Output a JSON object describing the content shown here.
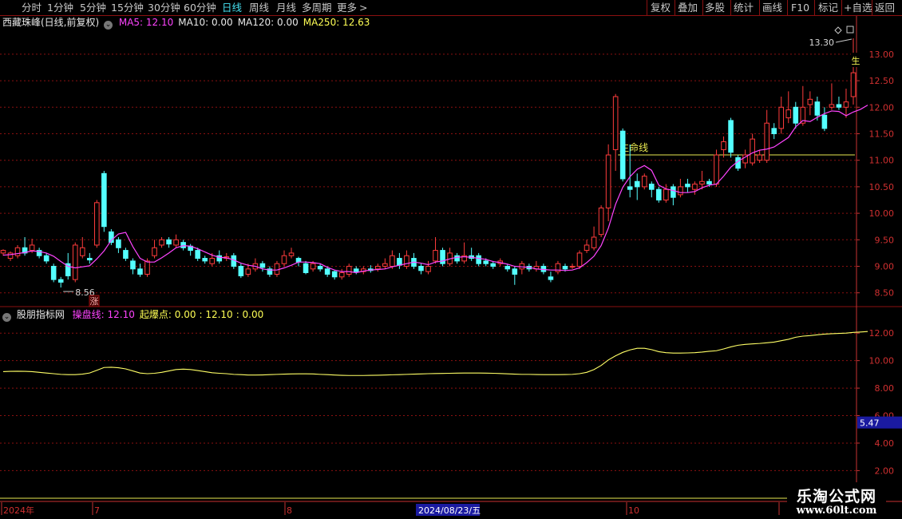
{
  "toolbar": {
    "periods": [
      {
        "label": "分时",
        "active": false
      },
      {
        "label": "1分钟",
        "active": false
      },
      {
        "label": "5分钟",
        "active": false
      },
      {
        "label": "15分钟",
        "active": false
      },
      {
        "label": "30分钟",
        "active": false
      },
      {
        "label": "60分钟",
        "active": false
      },
      {
        "label": "日线",
        "active": true
      },
      {
        "label": "周线",
        "active": false
      },
      {
        "label": "月线",
        "active": false
      },
      {
        "label": "多周期",
        "active": false
      },
      {
        "label": "更多",
        "active": false
      }
    ],
    "more_arrow": ">",
    "tools": [
      "复权",
      "叠加",
      "多股",
      "统计",
      "画线",
      "F10",
      "标记",
      "+自选",
      "返回"
    ]
  },
  "header": {
    "stock_title": "西藏珠峰(日线,前复权)",
    "ma_labels": [
      {
        "text": "MA5: 12.10",
        "color": "#ff44ff"
      },
      {
        "text": "MA10: 0.00",
        "color": "#e8e8e8"
      },
      {
        "text": "MA120: 0.00",
        "color": "#e8e8e8"
      },
      {
        "text": "MA250: 12.63",
        "color": "#ffff55"
      }
    ]
  },
  "indicator_header": {
    "name": "股朋指标网",
    "items": [
      {
        "text": "操盘线: 12.10",
        "color": "#ff44ff"
      },
      {
        "text": "起爆点: 0.00",
        "color": "#ffff55"
      },
      {
        "text": ": 12.10",
        "color": "#ffff55"
      },
      {
        "text": ": 0.00",
        "color": "#ffff55"
      }
    ]
  },
  "annotations": {
    "high_label": "13.30",
    "low_label": "8.56",
    "shengming": "生命线",
    "zhang": "涨",
    "sheng_edge": "生",
    "crosshair_value": "5.47"
  },
  "date_axis": {
    "labels": [
      "2024年",
      "7",
      "8",
      "10"
    ],
    "cursor_date": "2024/08/23/五"
  },
  "watermark": {
    "line1": "乐淘公式网",
    "line2": "www.60lt.com"
  },
  "colors": {
    "up": "#ff3c3c",
    "down": "#54ffff",
    "ma": "#ff44ff",
    "indicator": "#ffff66",
    "grid": "#8b1010",
    "axis": "#c83232",
    "level": "#e8e850"
  },
  "chart_data": {
    "type": "candlestick",
    "price_ylim": [
      8.3,
      13.45
    ],
    "price_ticks": [
      "13.00",
      "12.50",
      "12.00",
      "11.50",
      "11.00",
      "10.50",
      "10.00",
      "9.50",
      "9.00",
      "8.50"
    ],
    "indicator_ylim": [
      1.5,
      13.0
    ],
    "indicator_ticks": [
      "12.00",
      "10.00",
      "8.00",
      "6.00",
      "4.00",
      "2.00"
    ],
    "level_line": 11.1,
    "candles": [
      [
        9.25,
        9.3,
        9.2,
        9.32
      ],
      [
        9.15,
        9.25,
        9.1,
        9.28
      ],
      [
        9.2,
        9.35,
        9.15,
        9.4
      ],
      [
        9.35,
        9.25,
        9.2,
        9.55
      ],
      [
        9.3,
        9.4,
        9.25,
        9.52
      ],
      [
        9.3,
        9.2,
        9.15,
        9.35
      ],
      [
        9.2,
        9.1,
        9.05,
        9.25
      ],
      [
        9.0,
        8.75,
        8.7,
        9.05
      ],
      [
        8.75,
        8.7,
        8.6,
        8.8
      ],
      [
        9.05,
        8.82,
        8.75,
        9.25
      ],
      [
        8.75,
        9.4,
        8.7,
        9.45
      ],
      [
        9.2,
        9.35,
        9.15,
        9.55
      ],
      [
        9.15,
        9.12,
        9.05,
        9.25
      ],
      [
        9.4,
        10.2,
        9.35,
        10.25
      ],
      [
        10.75,
        9.75,
        9.65,
        10.8
      ],
      [
        9.65,
        9.45,
        9.4,
        9.7
      ],
      [
        9.5,
        9.35,
        9.25,
        9.55
      ],
      [
        9.3,
        9.15,
        9.1,
        9.35
      ],
      [
        9.1,
        8.95,
        8.85,
        9.15
      ],
      [
        8.95,
        8.85,
        8.8,
        9.05
      ],
      [
        8.85,
        9.1,
        8.8,
        9.15
      ],
      [
        9.2,
        9.35,
        9.15,
        9.5
      ],
      [
        9.4,
        9.5,
        9.35,
        9.55
      ],
      [
        9.5,
        9.42,
        9.35,
        9.55
      ],
      [
        9.4,
        9.5,
        9.35,
        9.6
      ],
      [
        9.45,
        9.35,
        9.3,
        9.5
      ],
      [
        9.38,
        9.3,
        9.2,
        9.42
      ],
      [
        9.3,
        9.15,
        9.1,
        9.35
      ],
      [
        9.15,
        9.1,
        9.05,
        9.2
      ],
      [
        9.05,
        9.15,
        9.0,
        9.25
      ],
      [
        9.2,
        9.1,
        9.05,
        9.3
      ],
      [
        9.15,
        9.18,
        9.1,
        9.25
      ],
      [
        9.2,
        9.0,
        8.95,
        9.25
      ],
      [
        9.0,
        8.82,
        8.78,
        9.05
      ],
      [
        8.85,
        8.95,
        8.8,
        9.05
      ],
      [
        8.95,
        9.05,
        8.9,
        9.15
      ],
      [
        9.05,
        8.98,
        8.9,
        9.1
      ],
      [
        8.95,
        8.85,
        8.8,
        9.0
      ],
      [
        8.85,
        9.05,
        8.8,
        9.1
      ],
      [
        9.05,
        9.2,
        9.0,
        9.3
      ],
      [
        9.2,
        9.25,
        9.15,
        9.35
      ],
      [
        9.15,
        9.08,
        9.0,
        9.18
      ],
      [
        9.05,
        8.88,
        8.85,
        9.1
      ],
      [
        8.95,
        9.05,
        8.9,
        9.1
      ],
      [
        9.0,
        8.95,
        8.9,
        9.05
      ],
      [
        8.95,
        8.85,
        8.8,
        9.0
      ],
      [
        8.9,
        8.8,
        8.75,
        8.92
      ],
      [
        8.8,
        8.88,
        8.75,
        8.95
      ],
      [
        8.85,
        9.0,
        8.8,
        9.05
      ],
      [
        8.95,
        8.9,
        8.85,
        9.0
      ],
      [
        8.9,
        8.95,
        8.85,
        9.0
      ],
      [
        8.95,
        8.92,
        8.88,
        9.02
      ],
      [
        8.95,
        9.0,
        8.9,
        9.05
      ],
      [
        9.0,
        9.05,
        8.95,
        9.15
      ],
      [
        9.0,
        9.2,
        8.95,
        9.3
      ],
      [
        9.15,
        9.02,
        8.95,
        9.25
      ],
      [
        9.0,
        9.2,
        8.95,
        9.3
      ],
      [
        9.15,
        9.0,
        8.95,
        9.25
      ],
      [
        9.0,
        8.92,
        8.85,
        9.05
      ],
      [
        8.9,
        9.0,
        8.85,
        9.1
      ],
      [
        9.1,
        9.3,
        9.05,
        9.55
      ],
      [
        9.3,
        9.05,
        9.0,
        9.35
      ],
      [
        9.05,
        9.25,
        9.0,
        9.35
      ],
      [
        9.2,
        9.1,
        9.05,
        9.25
      ],
      [
        9.1,
        9.2,
        9.05,
        9.45
      ],
      [
        9.2,
        9.15,
        9.1,
        9.35
      ],
      [
        9.2,
        9.05,
        9.0,
        9.25
      ],
      [
        9.1,
        9.05,
        9.0,
        9.15
      ],
      [
        9.05,
        9.0,
        8.95,
        9.1
      ],
      [
        9.05,
        9.1,
        9.0,
        9.15
      ],
      [
        9.0,
        8.95,
        8.9,
        9.05
      ],
      [
        8.95,
        8.85,
        8.65,
        9.0
      ],
      [
        8.95,
        9.05,
        8.85,
        9.1
      ],
      [
        9.0,
        8.95,
        8.9,
        9.05
      ],
      [
        8.95,
        9.0,
        8.9,
        9.1
      ],
      [
        9.0,
        8.9,
        8.85,
        9.05
      ],
      [
        8.8,
        8.75,
        8.7,
        8.9
      ],
      [
        8.9,
        9.05,
        8.85,
        9.1
      ],
      [
        9.0,
        8.95,
        8.9,
        9.05
      ],
      [
        9.0,
        9.0,
        8.95,
        9.05
      ],
      [
        9.0,
        9.25,
        8.95,
        9.3
      ],
      [
        9.3,
        9.4,
        9.25,
        9.5
      ],
      [
        9.35,
        9.55,
        9.3,
        9.75
      ],
      [
        9.6,
        10.1,
        9.55,
        10.15
      ],
      [
        10.1,
        11.1,
        9.85,
        11.3
      ],
      [
        11.2,
        12.2,
        10.8,
        12.25
      ],
      [
        11.55,
        10.65,
        10.6,
        11.6
      ],
      [
        10.5,
        10.45,
        10.3,
        11.3
      ],
      [
        10.6,
        10.5,
        10.25,
        10.75
      ],
      [
        10.5,
        10.7,
        10.45,
        10.75
      ],
      [
        10.55,
        10.45,
        10.3,
        10.6
      ],
      [
        10.45,
        10.25,
        10.2,
        10.5
      ],
      [
        10.25,
        10.45,
        10.2,
        10.55
      ],
      [
        10.5,
        10.3,
        10.15,
        10.55
      ],
      [
        10.35,
        10.5,
        10.3,
        10.65
      ],
      [
        10.55,
        10.5,
        10.4,
        10.65
      ],
      [
        10.45,
        10.55,
        10.35,
        10.6
      ],
      [
        10.55,
        10.6,
        10.45,
        10.8
      ],
      [
        10.6,
        10.55,
        10.5,
        10.65
      ],
      [
        10.55,
        11.1,
        10.5,
        11.2
      ],
      [
        11.2,
        11.35,
        11.05,
        11.45
      ],
      [
        11.75,
        11.15,
        11.05,
        11.8
      ],
      [
        11.05,
        10.85,
        10.8,
        11.1
      ],
      [
        10.95,
        11.1,
        10.85,
        11.2
      ],
      [
        10.95,
        11.4,
        10.9,
        11.5
      ],
      [
        11.0,
        11.1,
        10.95,
        11.2
      ],
      [
        11.0,
        11.7,
        10.95,
        11.95
      ],
      [
        11.6,
        11.5,
        11.4,
        11.7
      ],
      [
        11.6,
        12.0,
        11.5,
        12.2
      ],
      [
        11.8,
        11.95,
        11.7,
        12.3
      ],
      [
        12.0,
        11.7,
        11.6,
        12.1
      ],
      [
        11.7,
        12.0,
        11.65,
        12.4
      ],
      [
        12.05,
        12.15,
        11.85,
        12.3
      ],
      [
        12.1,
        11.85,
        11.75,
        12.2
      ],
      [
        11.85,
        11.6,
        11.55,
        12.0
      ],
      [
        12.0,
        12.05,
        11.95,
        12.45
      ],
      [
        12.05,
        12.0,
        11.95,
        12.2
      ],
      [
        12.0,
        12.1,
        11.8,
        12.35
      ],
      [
        12.2,
        12.65,
        12.05,
        13.3
      ]
    ],
    "ma5": [
      9.21,
      9.22,
      9.24,
      9.26,
      9.29,
      9.28,
      9.25,
      9.19,
      9.09,
      9.0,
      8.97,
      8.99,
      9.01,
      9.14,
      9.29,
      9.49,
      9.61,
      9.64,
      9.37,
      9.15,
      9.08,
      9.08,
      9.16,
      9.25,
      9.35,
      9.39,
      9.38,
      9.33,
      9.27,
      9.21,
      9.17,
      9.16,
      9.12,
      9.06,
      9.02,
      9.0,
      8.95,
      8.93,
      8.93,
      8.97,
      9.02,
      9.08,
      9.08,
      9.07,
      9.05,
      8.98,
      8.93,
      8.9,
      8.9,
      8.88,
      8.91,
      8.93,
      8.94,
      8.95,
      8.99,
      9.02,
      9.05,
      9.08,
      9.06,
      9.03,
      9.08,
      9.1,
      9.14,
      9.17,
      9.18,
      9.17,
      9.15,
      9.13,
      9.09,
      9.07,
      9.04,
      9.0,
      8.99,
      8.98,
      8.95,
      8.94,
      8.93,
      8.93,
      8.92,
      8.93,
      8.97,
      9.07,
      9.19,
      9.39,
      9.72,
      10.17,
      10.49,
      10.69,
      10.83,
      10.9,
      10.81,
      10.53,
      10.46,
      10.43,
      10.39,
      10.39,
      10.41,
      10.48,
      10.53,
      10.55,
      10.7,
      10.87,
      10.98,
      11.06,
      11.14,
      11.19,
      11.21,
      11.25,
      11.34,
      11.43,
      11.63,
      11.75,
      11.73,
      11.81,
      11.88,
      11.93,
      11.92,
      11.84,
      11.91,
      11.96,
      12.04
    ],
    "indicator": [
      9.2,
      9.22,
      9.23,
      9.22,
      9.2,
      9.15,
      9.1,
      9.05,
      9.0,
      8.98,
      8.98,
      9.02,
      9.1,
      9.3,
      9.5,
      9.52,
      9.48,
      9.4,
      9.25,
      9.1,
      9.05,
      9.08,
      9.15,
      9.25,
      9.35,
      9.38,
      9.35,
      9.28,
      9.2,
      9.12,
      9.08,
      9.05,
      9.0,
      8.98,
      8.95,
      8.95,
      8.96,
      8.98,
      9.0,
      9.02,
      9.03,
      9.04,
      9.04,
      9.03,
      9.0,
      8.98,
      8.95,
      8.93,
      8.92,
      8.92,
      8.92,
      8.93,
      8.94,
      8.95,
      8.97,
      8.98,
      9.0,
      9.02,
      9.03,
      9.05,
      9.06,
      9.07,
      9.08,
      9.09,
      9.1,
      9.1,
      9.1,
      9.09,
      9.08,
      9.06,
      9.04,
      9.02,
      9.0,
      9.0,
      8.99,
      8.98,
      8.98,
      8.98,
      8.99,
      9.0,
      9.05,
      9.15,
      9.35,
      9.65,
      10.05,
      10.35,
      10.6,
      10.78,
      10.9,
      10.9,
      10.8,
      10.65,
      10.58,
      10.55,
      10.55,
      10.56,
      10.58,
      10.62,
      10.68,
      10.72,
      10.85,
      11.0,
      11.12,
      11.18,
      11.22,
      11.25,
      11.3,
      11.35,
      11.45,
      11.55,
      11.7,
      11.78,
      11.82,
      11.88,
      11.93,
      11.96,
      11.98,
      12.0,
      12.05,
      12.08,
      12.12
    ]
  }
}
